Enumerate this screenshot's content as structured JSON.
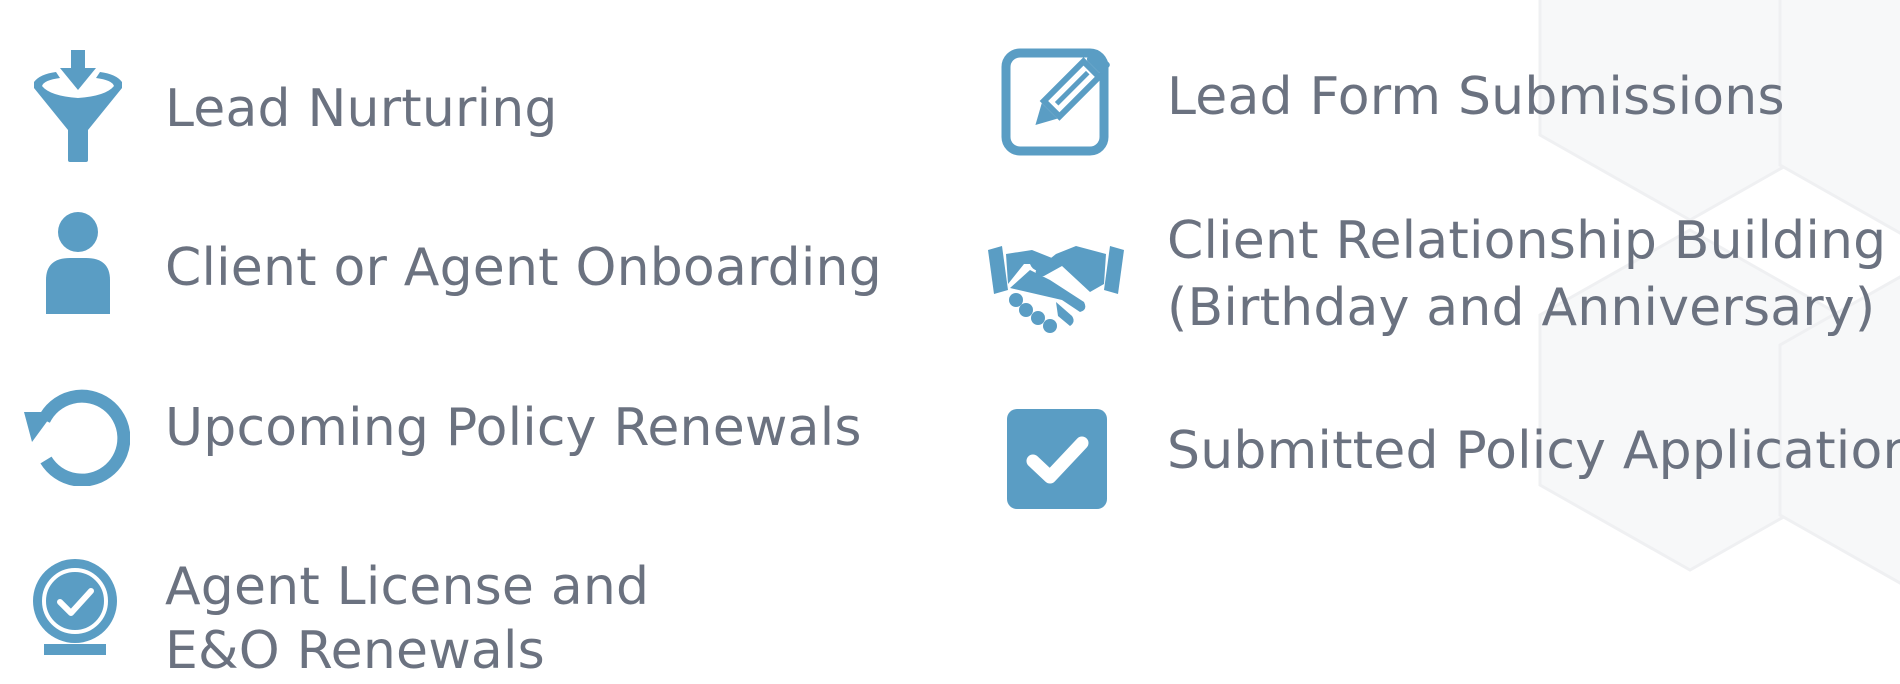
{
  "colors": {
    "icon": "#5a9dc4",
    "text": "#6b7280",
    "background": "#ffffff",
    "hex_pattern": "#f4f5f6"
  },
  "features": {
    "left": [
      {
        "label": "Lead Nurturing",
        "icon": "funnel-icon"
      },
      {
        "label": "Client or Agent Onboarding",
        "icon": "person-icon"
      },
      {
        "label": "Upcoming Policy Renewals",
        "icon": "renew-icon"
      },
      {
        "label_line1": "Agent License and",
        "label_line2": "E&O Renewals",
        "icon": "badge-check-icon"
      }
    ],
    "right": [
      {
        "label": "Lead Form Submissions",
        "icon": "edit-form-icon"
      },
      {
        "label_line1": "Client Relationship Building",
        "label_line2": "(Birthday and Anniversary)",
        "icon": "handshake-icon"
      },
      {
        "label": "Submitted Policy Applications",
        "icon": "checkbox-icon"
      }
    ]
  }
}
